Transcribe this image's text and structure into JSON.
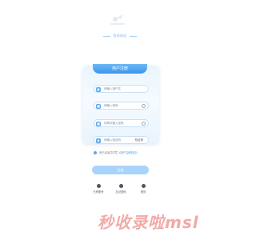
{
  "header": {
    "tagline": "我的网站"
  },
  "form": {
    "title": "用户注册",
    "fields": [
      {
        "icon": "user-icon",
        "placeholder": "请输入用户名"
      },
      {
        "icon": "lock-icon",
        "placeholder": "请输入密码"
      },
      {
        "icon": "lock-icon",
        "placeholder": "请再次输入密码"
      },
      {
        "icon": "shield-icon",
        "placeholder": "请输入验证码"
      }
    ],
    "captcha_text": "验证码",
    "agreement_prefix": "我已阅读并同意",
    "agreement_link": "《用户注册协议》",
    "submit_label": "注册"
  },
  "footer_links": [
    {
      "label": "已有账号"
    },
    {
      "label": "忘记密码"
    },
    {
      "label": "首页"
    }
  ],
  "watermark": "秒收录啦msl",
  "colors": {
    "accent": "#3b95ea",
    "button": "#a9d3fb",
    "watermark": "#f2aaa8"
  }
}
